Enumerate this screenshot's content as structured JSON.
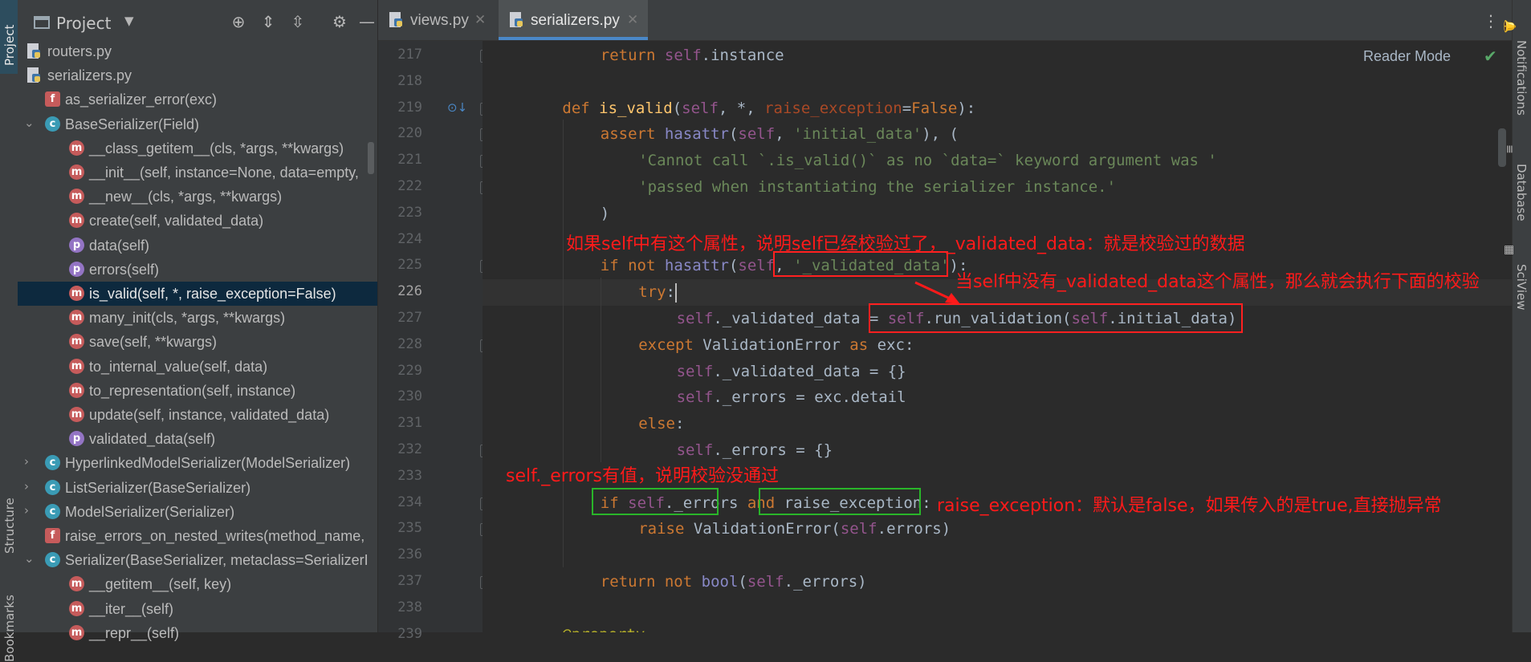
{
  "left_strip": {
    "tabs": [
      "Project",
      "Structure",
      "Bookmarks"
    ]
  },
  "project": {
    "title": "Project",
    "header_icons": [
      "crosshair-icon",
      "expand-all-icon",
      "collapse-all-icon",
      "gear-icon",
      "minimize-icon"
    ],
    "items": [
      {
        "type": "file",
        "label": "routers.py"
      },
      {
        "type": "file",
        "label": "serializers.py"
      },
      {
        "type": "f",
        "label": "as_serializer_error(exc)"
      },
      {
        "type": "c",
        "label": "BaseSerializer(Field)",
        "expanded": true
      },
      {
        "type": "m",
        "label": "__class_getitem__(cls, *args, **kwargs)"
      },
      {
        "type": "m",
        "label": "__init__(self, instance=None, data=empty,"
      },
      {
        "type": "m",
        "label": "__new__(cls, *args, **kwargs)"
      },
      {
        "type": "m",
        "label": "create(self, validated_data)"
      },
      {
        "type": "p",
        "label": "data(self)"
      },
      {
        "type": "p",
        "label": "errors(self)"
      },
      {
        "type": "m",
        "label": "is_valid(self, *, raise_exception=False)",
        "selected": true
      },
      {
        "type": "m",
        "label": "many_init(cls, *args, **kwargs)"
      },
      {
        "type": "m",
        "label": "save(self, **kwargs)"
      },
      {
        "type": "m",
        "label": "to_internal_value(self, data)"
      },
      {
        "type": "m",
        "label": "to_representation(self, instance)"
      },
      {
        "type": "m",
        "label": "update(self, instance, validated_data)"
      },
      {
        "type": "p",
        "label": "validated_data(self)"
      },
      {
        "type": "c",
        "label": "HyperlinkedModelSerializer(ModelSerializer)",
        "expanded": false
      },
      {
        "type": "c",
        "label": "ListSerializer(BaseSerializer)",
        "expanded": false
      },
      {
        "type": "c",
        "label": "ModelSerializer(Serializer)",
        "expanded": false
      },
      {
        "type": "f",
        "label": "raise_errors_on_nested_writes(method_name,"
      },
      {
        "type": "c",
        "label": "Serializer(BaseSerializer, metaclass=SerializerI",
        "expanded": true
      },
      {
        "type": "m",
        "label": "__getitem__(self, key)"
      },
      {
        "type": "m",
        "label": "__iter__(self)"
      },
      {
        "type": "m",
        "label": "__repr__(self)"
      }
    ]
  },
  "tabs": [
    {
      "label": "views.py",
      "active": false
    },
    {
      "label": "serializers.py",
      "active": true
    }
  ],
  "editor": {
    "reader_mode": "Reader Mode",
    "current_line": 226,
    "lines": [
      {
        "no": 217,
        "indent": 2,
        "html": "<span class='kw'>return</span> <span class='self'>self</span>.instance"
      },
      {
        "no": 218,
        "indent": 0,
        "html": ""
      },
      {
        "no": 219,
        "indent": 1,
        "html": "<span class='kw'>def</span> <span class='fn'>is_valid</span>(<span class='self'>self</span>, *, <span class='param'>raise_exception</span>=<span class='kw'>False</span>):"
      },
      {
        "no": 220,
        "indent": 2,
        "html": "<span class='kw'>assert</span> <span class='bi'>hasattr</span>(<span class='self'>self</span>, <span class='str'>'initial_data'</span>), ("
      },
      {
        "no": 221,
        "indent": 3,
        "html": "<span class='str'>'Cannot call `.is_valid()` as no `data=` keyword argument was '</span>"
      },
      {
        "no": 222,
        "indent": 3,
        "html": "<span class='str'>'passed when instantiating the serializer instance.'</span>"
      },
      {
        "no": 223,
        "indent": 2,
        "html": ")"
      },
      {
        "no": 224,
        "indent": 0,
        "html": ""
      },
      {
        "no": 225,
        "indent": 2,
        "html": "<span class='kw'>if not</span> <span class='bi'>hasattr</span>(<span class='self'>self</span>, <span class='str'>'_validated_data'</span>):"
      },
      {
        "no": 226,
        "indent": 3,
        "html": "<span class='kw'>try</span>:<span class='caret'></span>"
      },
      {
        "no": 227,
        "indent": 4,
        "html": "<span class='self'>self</span>._validated_data = <span class='self'>self</span>.run_validation(<span class='self'>self</span>.initial_data)"
      },
      {
        "no": 228,
        "indent": 3,
        "html": "<span class='kw'>except</span> ValidationError <span class='kw'>as</span> exc:"
      },
      {
        "no": 229,
        "indent": 4,
        "html": "<span class='self'>self</span>._validated_data = {}"
      },
      {
        "no": 230,
        "indent": 4,
        "html": "<span class='self'>self</span>._errors = exc.detail"
      },
      {
        "no": 231,
        "indent": 3,
        "html": "<span class='kw'>else</span>:"
      },
      {
        "no": 232,
        "indent": 4,
        "html": "<span class='self'>self</span>._errors = {}"
      },
      {
        "no": 233,
        "indent": 0,
        "html": ""
      },
      {
        "no": 234,
        "indent": 2,
        "html": "<span class='kw'>if</span> <span class='self'>self</span>._errors <span class='kw'>and</span> raise_exception:"
      },
      {
        "no": 235,
        "indent": 3,
        "html": "<span class='kw'>raise</span> ValidationError(<span class='self'>self</span>.errors)"
      },
      {
        "no": 236,
        "indent": 0,
        "html": ""
      },
      {
        "no": 237,
        "indent": 2,
        "html": "<span class='kw'>return not</span> <span class='bi'>bool</span>(<span class='self'>self</span>._errors)"
      },
      {
        "no": 238,
        "indent": 0,
        "html": ""
      },
      {
        "no": 239,
        "indent": 1,
        "html": "<span class='dec'>@property</span>"
      }
    ]
  },
  "annotations": {
    "note1": "如果self中有这个属性，说明self已经校验过了，_validated_data：就是校验过的数据",
    "note2": "当self中没有_validated_data这个属性，那么就会执行下面的校验",
    "note3": "self._errors有值，说明校验没通过",
    "note4": "raise_exception：默认是false，如果传入的是true,直接抛异常"
  },
  "right_strip": {
    "tabs": [
      "Notifications",
      "Database",
      "SciView"
    ]
  },
  "colors": {
    "annotation": "#ff1a1a",
    "box_red": "#ff2020",
    "box_green": "#29b529"
  }
}
